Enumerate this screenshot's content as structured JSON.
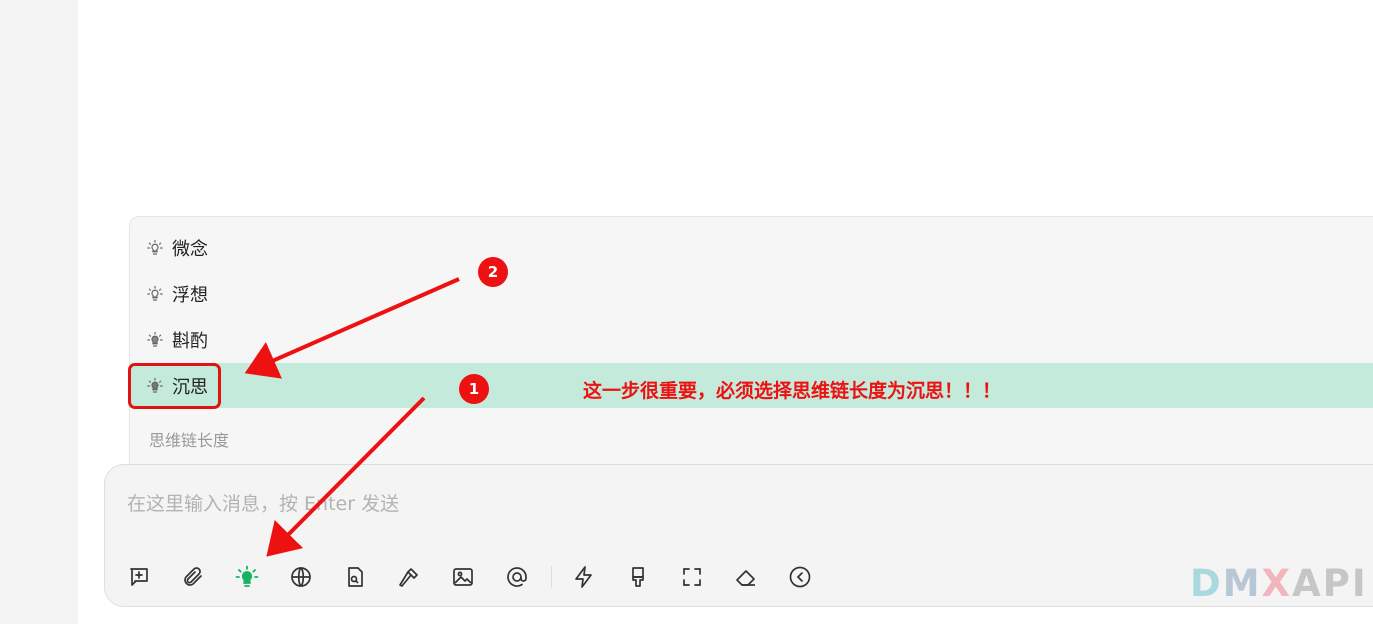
{
  "thinking_menu": {
    "items": [
      {
        "label": "微念",
        "active": false
      },
      {
        "label": "浮想",
        "active": false
      },
      {
        "label": "斟酌",
        "active": false
      },
      {
        "label": "沉思",
        "active": true
      }
    ],
    "footer_label": "思维链长度",
    "active_color": "#c3eadb"
  },
  "composer": {
    "placeholder": "在这里输入消息，按 Enter 发送",
    "toolbar_icons": [
      "new-topic-icon",
      "attachment-icon",
      "thinking-bulb-icon",
      "web-search-icon",
      "knowledge-file-icon",
      "tools-hammer-icon",
      "image-icon",
      "mention-icon",
      "quick-phrase-icon",
      "clear-style-icon",
      "expand-icon",
      "eraser-icon",
      "collapse-icon"
    ],
    "active_icon_color": "#16b364"
  },
  "annotations": {
    "badge_1": "1",
    "badge_2": "2",
    "note": "这一步很重要，必须选择思维链长度为沉思！！！",
    "color": "#ee1111"
  },
  "watermark": {
    "d": "D",
    "m": "M",
    "x": "X",
    "api": "API"
  }
}
